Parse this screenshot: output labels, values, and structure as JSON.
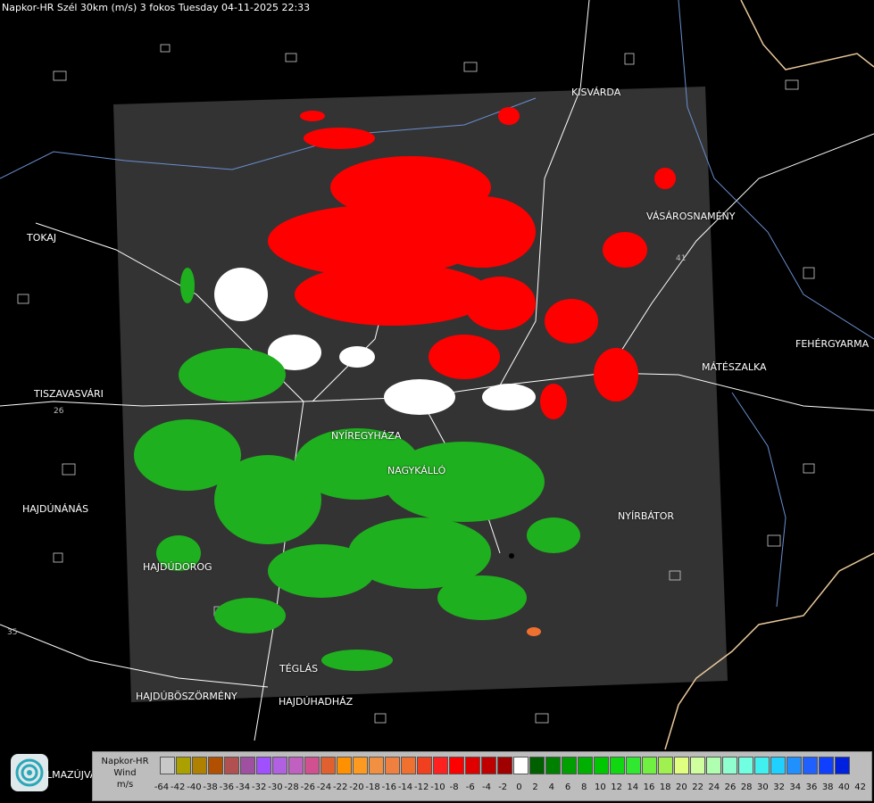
{
  "title": "Napkor-HR Szél 30km (m/s) 3 fokos Tuesday 04-11-2025 22:33",
  "cities": [
    {
      "name": "KISVÁRDA"
    },
    {
      "name": "TOKAJ"
    },
    {
      "name": "VÁSÁROSNAMÉNY"
    },
    {
      "name": "FEHÉRGYARMA"
    },
    {
      "name": "MÁTÉSZALKA"
    },
    {
      "name": "TISZAVASVÁRI"
    },
    {
      "name": "NYÍREGYHÁZA"
    },
    {
      "name": "NAGYKÁLLÓ"
    },
    {
      "name": "HAJDÚNÁNÁS"
    },
    {
      "name": "NYÍRBÁTOR"
    },
    {
      "name": "HAJDÚDOROG"
    },
    {
      "name": "TÉGLÁS"
    },
    {
      "name": "HAJDÚBÖSZÖRMÉNY"
    },
    {
      "name": "HAJDÚHADHÁZ"
    }
  ],
  "road_numbers": [
    "41",
    "26",
    "35"
  ],
  "legend": {
    "line1": "Napkor-HR",
    "line2": "Wind",
    "line3": "m/s",
    "ticks": [
      "-64",
      "-42",
      "-40",
      "-38",
      "-36",
      "-34",
      "-32",
      "-30",
      "-28",
      "-26",
      "-24",
      "-22",
      "-20",
      "-18",
      "-16",
      "-14",
      "-12",
      "-10",
      "-8",
      "-6",
      "-4",
      "-2",
      "0",
      "2",
      "4",
      "6",
      "8",
      "10",
      "12",
      "14",
      "16",
      "18",
      "20",
      "22",
      "24",
      "26",
      "28",
      "30",
      "32",
      "34",
      "36",
      "38",
      "40",
      "42"
    ],
    "colors": [
      "#c8c8c8",
      "#aaa000",
      "#b08000",
      "#b05000",
      "#b05050",
      "#a050a0",
      "#a050ff",
      "#b060e0",
      "#c060c0",
      "#d05090",
      "#e06030",
      "#ff9000",
      "#ff9a20",
      "#f09040",
      "#f08040",
      "#f07030",
      "#f04020",
      "#ff2020",
      "#ff0000",
      "#e00000",
      "#c00000",
      "#a00000",
      "#ffffff",
      "#006000",
      "#008000",
      "#00a000",
      "#00b000",
      "#00c800",
      "#10d810",
      "#30e830",
      "#70f040",
      "#a0f050",
      "#e0ff80",
      "#d0ffa0",
      "#b0ffb0",
      "#90ffd0",
      "#70ffe0",
      "#40f0f0",
      "#20d0ff",
      "#2090ff",
      "#2060ff",
      "#1040ff",
      "#0020e0"
    ]
  },
  "logo_text": "LMAZÚJVÁR"
}
